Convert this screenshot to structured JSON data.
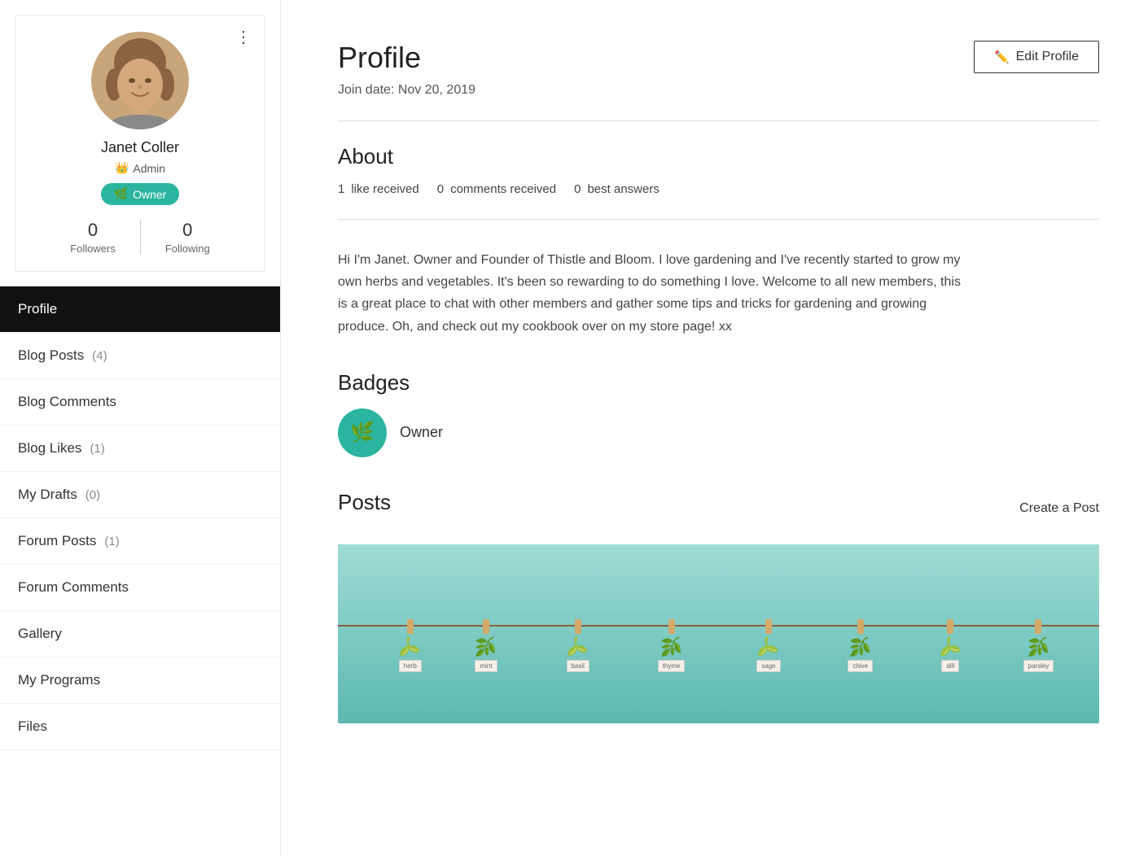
{
  "sidebar": {
    "user": {
      "name": "Janet Coller",
      "admin_label": "Admin",
      "owner_label": "Owner",
      "followers": 0,
      "following": 0,
      "followers_label": "Followers",
      "following_label": "Following"
    },
    "more_dots": "⋮",
    "nav_items": [
      {
        "id": "profile",
        "label": "Profile",
        "count": null,
        "active": true
      },
      {
        "id": "blog-posts",
        "label": "Blog Posts",
        "count": 4,
        "active": false
      },
      {
        "id": "blog-comments",
        "label": "Blog Comments",
        "count": null,
        "active": false
      },
      {
        "id": "blog-likes",
        "label": "Blog Likes",
        "count": 1,
        "active": false
      },
      {
        "id": "my-drafts",
        "label": "My Drafts",
        "count": 0,
        "active": false
      },
      {
        "id": "forum-posts",
        "label": "Forum Posts",
        "count": 1,
        "active": false
      },
      {
        "id": "forum-comments",
        "label": "Forum Comments",
        "count": null,
        "active": false
      },
      {
        "id": "gallery",
        "label": "Gallery",
        "count": null,
        "active": false
      },
      {
        "id": "my-programs",
        "label": "My Programs",
        "count": null,
        "active": false
      },
      {
        "id": "files",
        "label": "Files",
        "count": null,
        "active": false
      }
    ]
  },
  "main": {
    "page_title": "Profile",
    "edit_profile_label": "Edit Profile",
    "join_date": "Join date: Nov 20, 2019",
    "about_section": {
      "title": "About",
      "likes_received_count": 1,
      "likes_received_label": "like received",
      "comments_received_count": 0,
      "comments_received_label": "comments received",
      "best_answers_count": 0,
      "best_answers_label": "best answers",
      "bio": "Hi I'm Janet. Owner and Founder of Thistle and Bloom. I love gardening and I've recently started to grow my own herbs and vegetables. It's been so rewarding to do something I love. Welcome to all new members, this is a great place to chat with other members and gather some tips and tricks for gardening and growing produce. Oh, and check out my cookbook over on my store page! xx"
    },
    "badges_section": {
      "title": "Badges",
      "badge_name": "Owner"
    },
    "posts_section": {
      "title": "Posts",
      "create_post_label": "Create a Post"
    }
  },
  "colors": {
    "teal": "#2bb5a0",
    "black": "#111111",
    "white": "#ffffff"
  }
}
